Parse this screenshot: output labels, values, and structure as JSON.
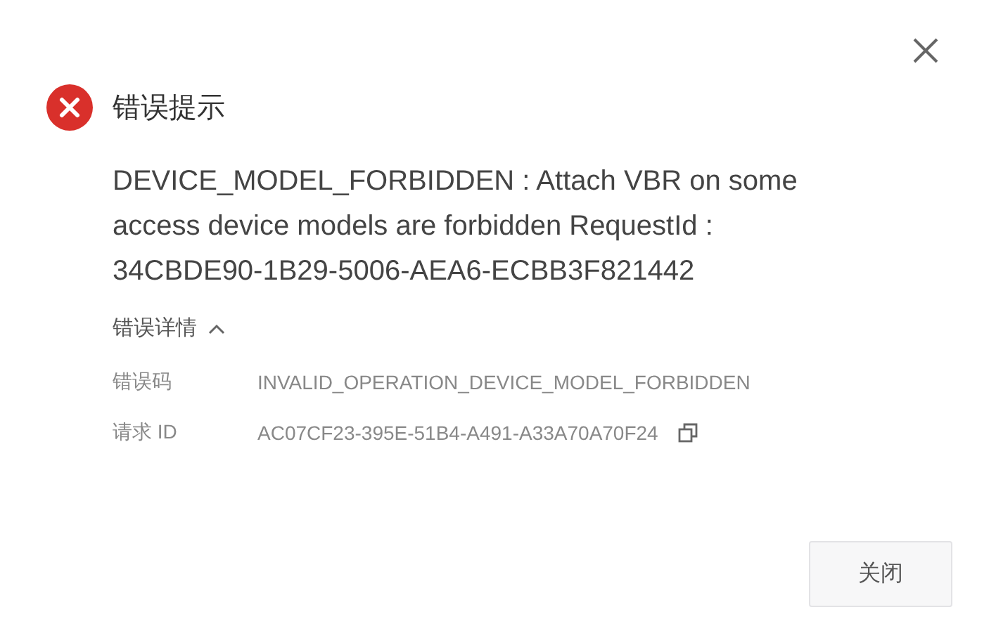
{
  "dialog": {
    "title": "错误提示",
    "message": "DEVICE_MODEL_FORBIDDEN : Attach VBR on some access device models are forbidden RequestId : 34CBDE90-1B29-5006-AEA6-ECBB3F821442",
    "details": {
      "label": "错误详情",
      "expanded": true,
      "rows": [
        {
          "label": "错误码",
          "value": "INVALID_OPERATION_DEVICE_MODEL_FORBIDDEN",
          "copyable": false
        },
        {
          "label": "请求 ID",
          "value": "AC07CF23-395E-51B4-A491-A33A70A70F24",
          "copyable": true
        }
      ]
    },
    "buttons": [
      "关闭"
    ]
  }
}
